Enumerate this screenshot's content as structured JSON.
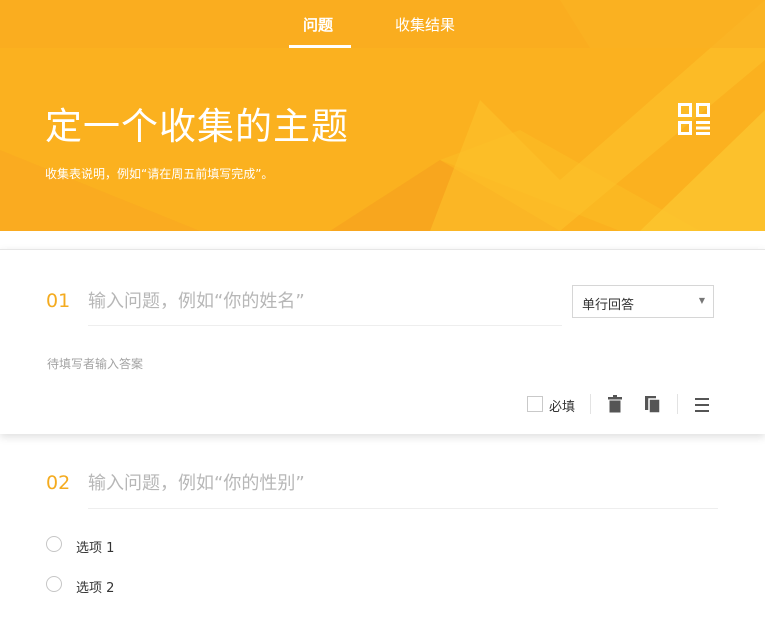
{
  "tabs": [
    {
      "label": "问题",
      "active": true
    },
    {
      "label": "收集结果",
      "active": false
    }
  ],
  "header": {
    "title": "定一个收集的主题",
    "description": "收集表说明，例如“请在周五前填写完成”。",
    "qr_icon": "qr-code-icon"
  },
  "questions": [
    {
      "number": "01",
      "placeholder": "输入问题，例如“你的姓名”",
      "type_label": "单行回答",
      "answer_hint": "待填写者输入答案",
      "required_label": "必填"
    },
    {
      "number": "02",
      "placeholder": "输入问题，例如“你的性别”",
      "options": [
        "选项 1",
        "选项 2"
      ]
    }
  ],
  "toolbar_icons": [
    "trash-icon",
    "copy-icon",
    "menu-icon"
  ],
  "colors": {
    "brand": "#fbb11f",
    "accent_number": "#f4ab1f"
  }
}
